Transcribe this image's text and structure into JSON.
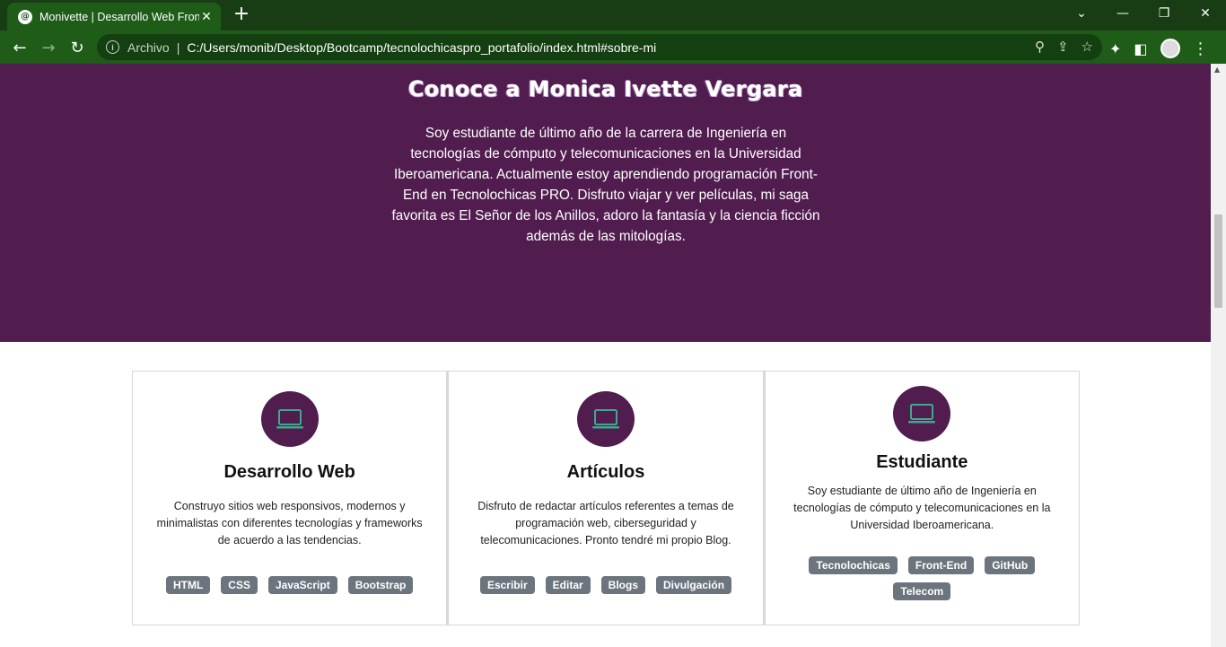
{
  "browser": {
    "tab_title": "Monivette | Desarrollo Web Front",
    "tab_close": "✕",
    "new_tab": "+",
    "scheme_label": "Archivo",
    "separator": "|",
    "url": "C:/Users/monib/Desktop/Bootcamp/tecnolochicaspro_portafolio/index.html#sobre-mi",
    "window_controls": {
      "tab_search": "⌄",
      "minimize": "—",
      "restore": "❐",
      "close": "✕"
    },
    "nav": {
      "back": "←",
      "forward": "→",
      "reload": "↻"
    },
    "icons": [
      "info-icon",
      "zoom-icon",
      "share-icon",
      "star-icon",
      "extensions-icon",
      "sidepanel-icon",
      "profile-avatar",
      "menu-icon"
    ]
  },
  "about": {
    "title": "Conoce a Monica Ivette Vergara",
    "text": "Soy estudiante de último año de la carrera de Ingeniería en tecnologías de cómputo y telecomunicaciones en la Universidad Iberoamericana. Actualmente estoy aprendiendo programación Front-End en Tecnolochicas PRO. Disfruto viajar y ver películas, mi saga favorita es El Señor de los Anillos, adoro la fantasía y la ciencia ficción además de las mitologías.",
    "background_color": "#511d4f"
  },
  "cards": [
    {
      "title": "Desarrollo Web",
      "text": "Construyo sitios web responsivos, modernos y minimalistas con diferentes tecnologías y frameworks de acuerdo a las tendencias.",
      "icon": "laptop-icon",
      "badges": [
        "HTML",
        "CSS",
        "JavaScript",
        "Bootstrap"
      ]
    },
    {
      "title": "Artículos",
      "text": "Disfruto de redactar artículos referentes a temas de programación web, ciberseguridad y telecomunicaciones. Pronto tendré mi propio Blog.",
      "icon": "laptop-icon",
      "badges": [
        "Escribir",
        "Editar",
        "Blogs",
        "Divulgación"
      ]
    },
    {
      "title": "Estudiante",
      "text": "Soy estudiante de último año de Ingeniería en tecnologías de cómputo y telecomunicaciones en la Universidad Iberoamericana.",
      "icon": "laptop-icon",
      "badges": [
        "Tecnolochicas",
        "Front-End",
        "GitHub",
        "Telecom"
      ]
    }
  ],
  "colors": {
    "accent_purple": "#511d4f",
    "chrome_green": "#1e5c18",
    "badge_gray": "#6c757d",
    "icon_teal": "#3fa88e"
  }
}
